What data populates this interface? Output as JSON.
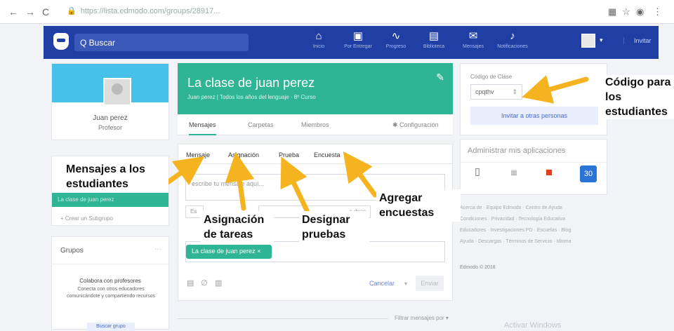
{
  "browser": {
    "url": "https://lista.edmodo.com/groups/28917...",
    "nav_back": "←",
    "nav_forward": "→",
    "nav_reload": "C",
    "icons": [
      "puzzle-icon",
      "star-icon",
      "account-icon",
      "menu-icon"
    ]
  },
  "topbar": {
    "search_placeholder": "Q Buscar",
    "nav": [
      {
        "label": "Inicio",
        "icon": "home-icon",
        "glyph": "⌂"
      },
      {
        "label": "Por Entregar",
        "icon": "assignment-icon",
        "glyph": "▣"
      },
      {
        "label": "Progreso",
        "icon": "progress-icon",
        "glyph": "∿"
      },
      {
        "label": "Biblioteca",
        "icon": "library-icon",
        "glyph": "▤"
      },
      {
        "label": "Mensajes",
        "icon": "messages-icon",
        "glyph": "✉"
      },
      {
        "label": "Notificaciones",
        "icon": "bell-icon",
        "glyph": "♪"
      }
    ],
    "invite": "Invitar"
  },
  "profile": {
    "name": "Juan perez",
    "role": "Profesor"
  },
  "groups_nav": {
    "active_group": "La clase de juan perez",
    "create": "+ Crear un Subgrupo"
  },
  "groups": {
    "title": "Grupos",
    "collab_title": "Colabora con profesores",
    "collab_text": "Conecta con otros educadores comunicándote y compartiendo recursos",
    "collab_button": "Buscar grupo"
  },
  "class": {
    "title": "La clase de juan perez",
    "subtitle": "Juan perez | Todos los años del lenguaje · 8º Curso",
    "tabs": [
      "Mensajes",
      "Carpetas",
      "Miembros"
    ],
    "settings": "✱ Configuración"
  },
  "composer": {
    "tabs": [
      "Mensaje",
      "Asignación",
      "Prueba",
      "Encuesta"
    ],
    "placeholder": "escribe tu mensaje aquí...",
    "field1": "Es",
    "field2": "a desc",
    "field3": "anuncio",
    "recipient": "La clase de juan perez ×",
    "cancel": "Cancelar",
    "send": "Enviar",
    "filter": "Filtrar mensajes por ▾"
  },
  "annotations": {
    "messages": "Mensajes a los estudiantes",
    "assignment": "Asignación de tareas",
    "quiz": "Designar pruebas",
    "poll": "Agregar encuestas",
    "code": "Código para los estudiantes"
  },
  "right": {
    "code_label": "Código de Clase",
    "code_value": "cpqthv",
    "invite_button": "Invitar a otras personas",
    "apps_title": "Administrar mis aplicaciones",
    "footer": [
      "Acerca de · Equipo Edmodo · Centro de Ayuda",
      "Condiciones · Privacidad · Tecnología Educativa",
      "Educadores · Investigaciones PD · Escuelas · Blog",
      "Ayuda · Descargas · Términos de Servicio · Idioma",
      "Edmodo © 2018"
    ],
    "windows": "Activar Windows"
  },
  "colors": {
    "brand": "#1f3fa5",
    "teal": "#2fb495",
    "arrow": "#f4b31f"
  }
}
